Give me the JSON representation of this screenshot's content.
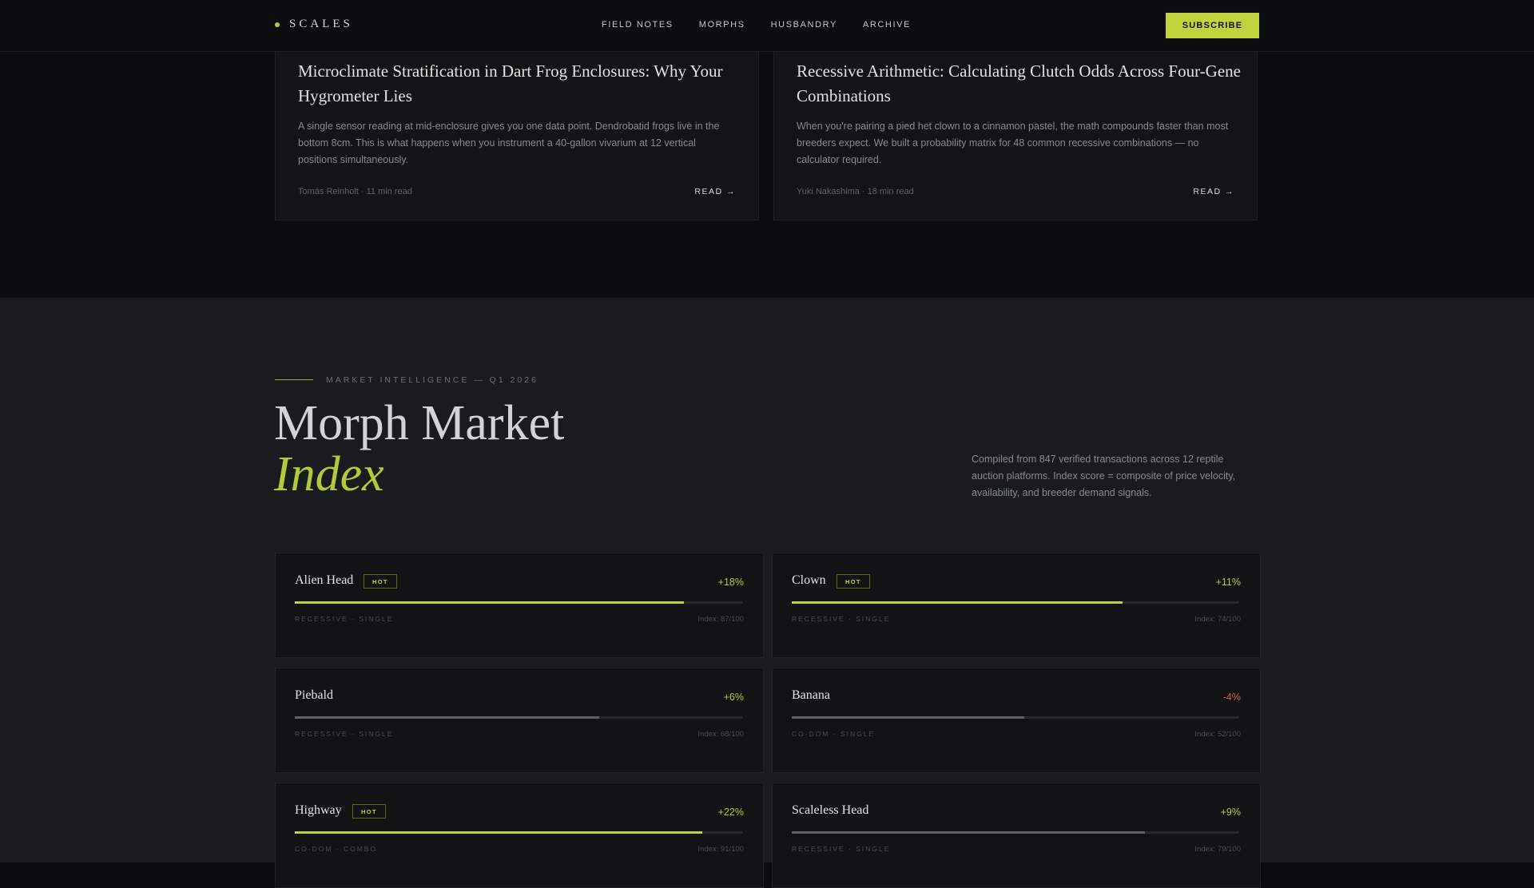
{
  "nav": {
    "brand": "SCALES",
    "links": [
      "FIELD NOTES",
      "MORPHS",
      "HUSBANDRY",
      "ARCHIVE"
    ],
    "subscribe_label": "SUBSCRIBE"
  },
  "articles": [
    {
      "title": "Microclimate Stratification in Dart Frog Enclosures: Why Your Hygrometer Lies",
      "excerpt": "A single sensor reading at mid-enclosure gives you one data point. Dendrobatid frogs live in the bottom 8cm. This is what happens when you instrument a 40-gallon vivarium at 12 vertical positions simultaneously.",
      "meta": "Tomás Reinholt · 11 min read",
      "read_label": "READ →"
    },
    {
      "title": "Recessive Arithmetic: Calculating Clutch Odds Across Four-Gene Combinations",
      "excerpt": "When you're pairing a pied het clown to a cinnamon pastel, the math compounds faster than most breeders expect. We built a probability matrix for 48 common recessive combinations — no calculator required.",
      "meta": "Yuki Nakashima · 18 min read",
      "read_label": "READ →"
    }
  ],
  "market": {
    "eyebrow": "MARKET INTELLIGENCE — Q1 2026",
    "title_line1": "Morph Market",
    "title_line2": "Index",
    "description": "Compiled from 847 verified transactions across 12 reptile auction platforms. Index score = composite of price velocity, availability, and breeder demand signals.",
    "hot_label": "HOT",
    "items": [
      {
        "name": "Alien Head",
        "hot": true,
        "change": "+18%",
        "direction": "up",
        "tag": "RECESSIVE · SINGLE",
        "index_label": "Index: 87/100",
        "index": 87
      },
      {
        "name": "Clown",
        "hot": true,
        "change": "+11%",
        "direction": "up",
        "tag": "RECESSIVE · SINGLE",
        "index_label": "Index: 74/100",
        "index": 74
      },
      {
        "name": "Piebald",
        "hot": false,
        "change": "+6%",
        "direction": "up",
        "tag": "RECESSIVE · SINGLE",
        "index_label": "Index: 68/100",
        "index": 68
      },
      {
        "name": "Banana",
        "hot": false,
        "change": "-4%",
        "direction": "down",
        "tag": "CO-DOM · SINGLE",
        "index_label": "Index: 52/100",
        "index": 52
      },
      {
        "name": "Highway",
        "hot": true,
        "change": "+22%",
        "direction": "up",
        "tag": "CO-DOM · COMBO",
        "index_label": "Index: 91/100",
        "index": 91
      },
      {
        "name": "Scaleless Head",
        "hot": false,
        "change": "+9%",
        "direction": "up",
        "tag": "RECESSIVE · SINGLE",
        "index_label": "Index: 79/100",
        "index": 79
      }
    ]
  },
  "colors": {
    "accent": "#bfd43c",
    "negative": "#d75c52",
    "background": "#0b0c0d",
    "section_background": "#181c1e"
  }
}
